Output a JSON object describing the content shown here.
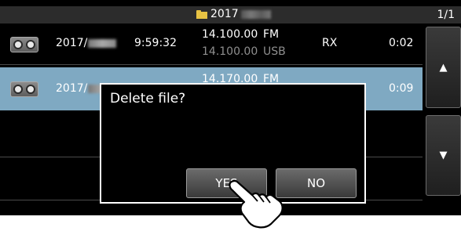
{
  "header": {
    "folder_icon": "folder-icon",
    "folder_title": "2017",
    "page_indicator": "1/1"
  },
  "files": [
    {
      "icon": "tape-icon",
      "date": "2017/",
      "time": "9:59:32",
      "freq_main": "14.100.00",
      "mode_main": "FM",
      "freq_sub": "14.100.00",
      "mode_sub": "USB",
      "type": "RX",
      "duration": "0:02",
      "selected": false
    },
    {
      "icon": "tape-icon",
      "date": "2017/",
      "freq_main": "14.170.00",
      "mode_main": "FM",
      "duration": "0:09",
      "selected": true
    }
  ],
  "scroll": {
    "up_icon": "triangle-up-icon",
    "up_label": "▲",
    "down_icon": "triangle-down-icon",
    "down_label": "▼"
  },
  "dialog": {
    "message": "Delete file?",
    "yes_label": "YES",
    "no_label": "NO"
  },
  "pointer_icon": "hand-pointer-icon",
  "colors": {
    "selected_row": "#7fa9c2",
    "folder": "#e7c243",
    "background": "#000000"
  }
}
